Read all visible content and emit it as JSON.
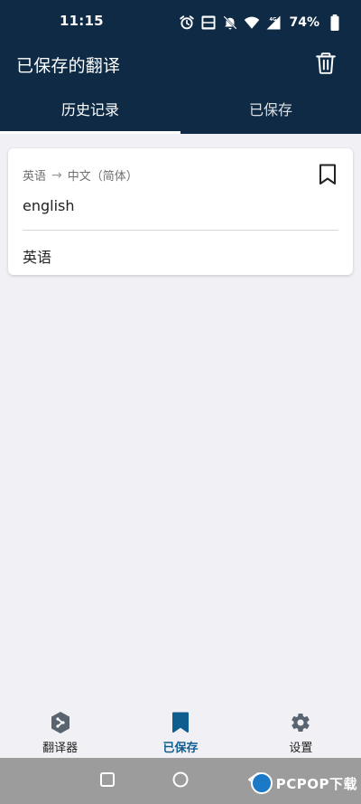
{
  "status_bar": {
    "time": "11:15",
    "battery_percent": "74%",
    "icons": [
      "alarm-icon",
      "volte-icon",
      "mute-icon",
      "wifi-icon",
      "signal-4g-icon",
      "battery-icon"
    ]
  },
  "app_bar": {
    "title": "已保存的翻译",
    "delete_icon": "trash-icon"
  },
  "tabs": [
    {
      "label": "历史记录",
      "active": true
    },
    {
      "label": "已保存",
      "active": false
    }
  ],
  "saved_items": [
    {
      "source_lang": "英语",
      "arrow": "→",
      "target_lang": "中文（简体）",
      "source_text": "english",
      "translation": "英语",
      "bookmark_icon": "bookmark-outline-icon"
    }
  ],
  "bottom_nav": [
    {
      "label": "翻译器",
      "icon": "translator-icon",
      "active": false
    },
    {
      "label": "已保存",
      "icon": "bookmark-icon",
      "active": true
    },
    {
      "label": "设置",
      "icon": "gear-icon",
      "active": false
    }
  ],
  "system_nav": {
    "buttons": [
      "recents-button",
      "home-button",
      "back-button"
    ]
  },
  "watermark": {
    "text": "PCPOP下载"
  },
  "colors": {
    "header_bg": "#0f2a44",
    "screen_bg": "#f1f0f5",
    "accent": "#0f5d8f",
    "system_nav_bg": "#9c9c9c"
  }
}
